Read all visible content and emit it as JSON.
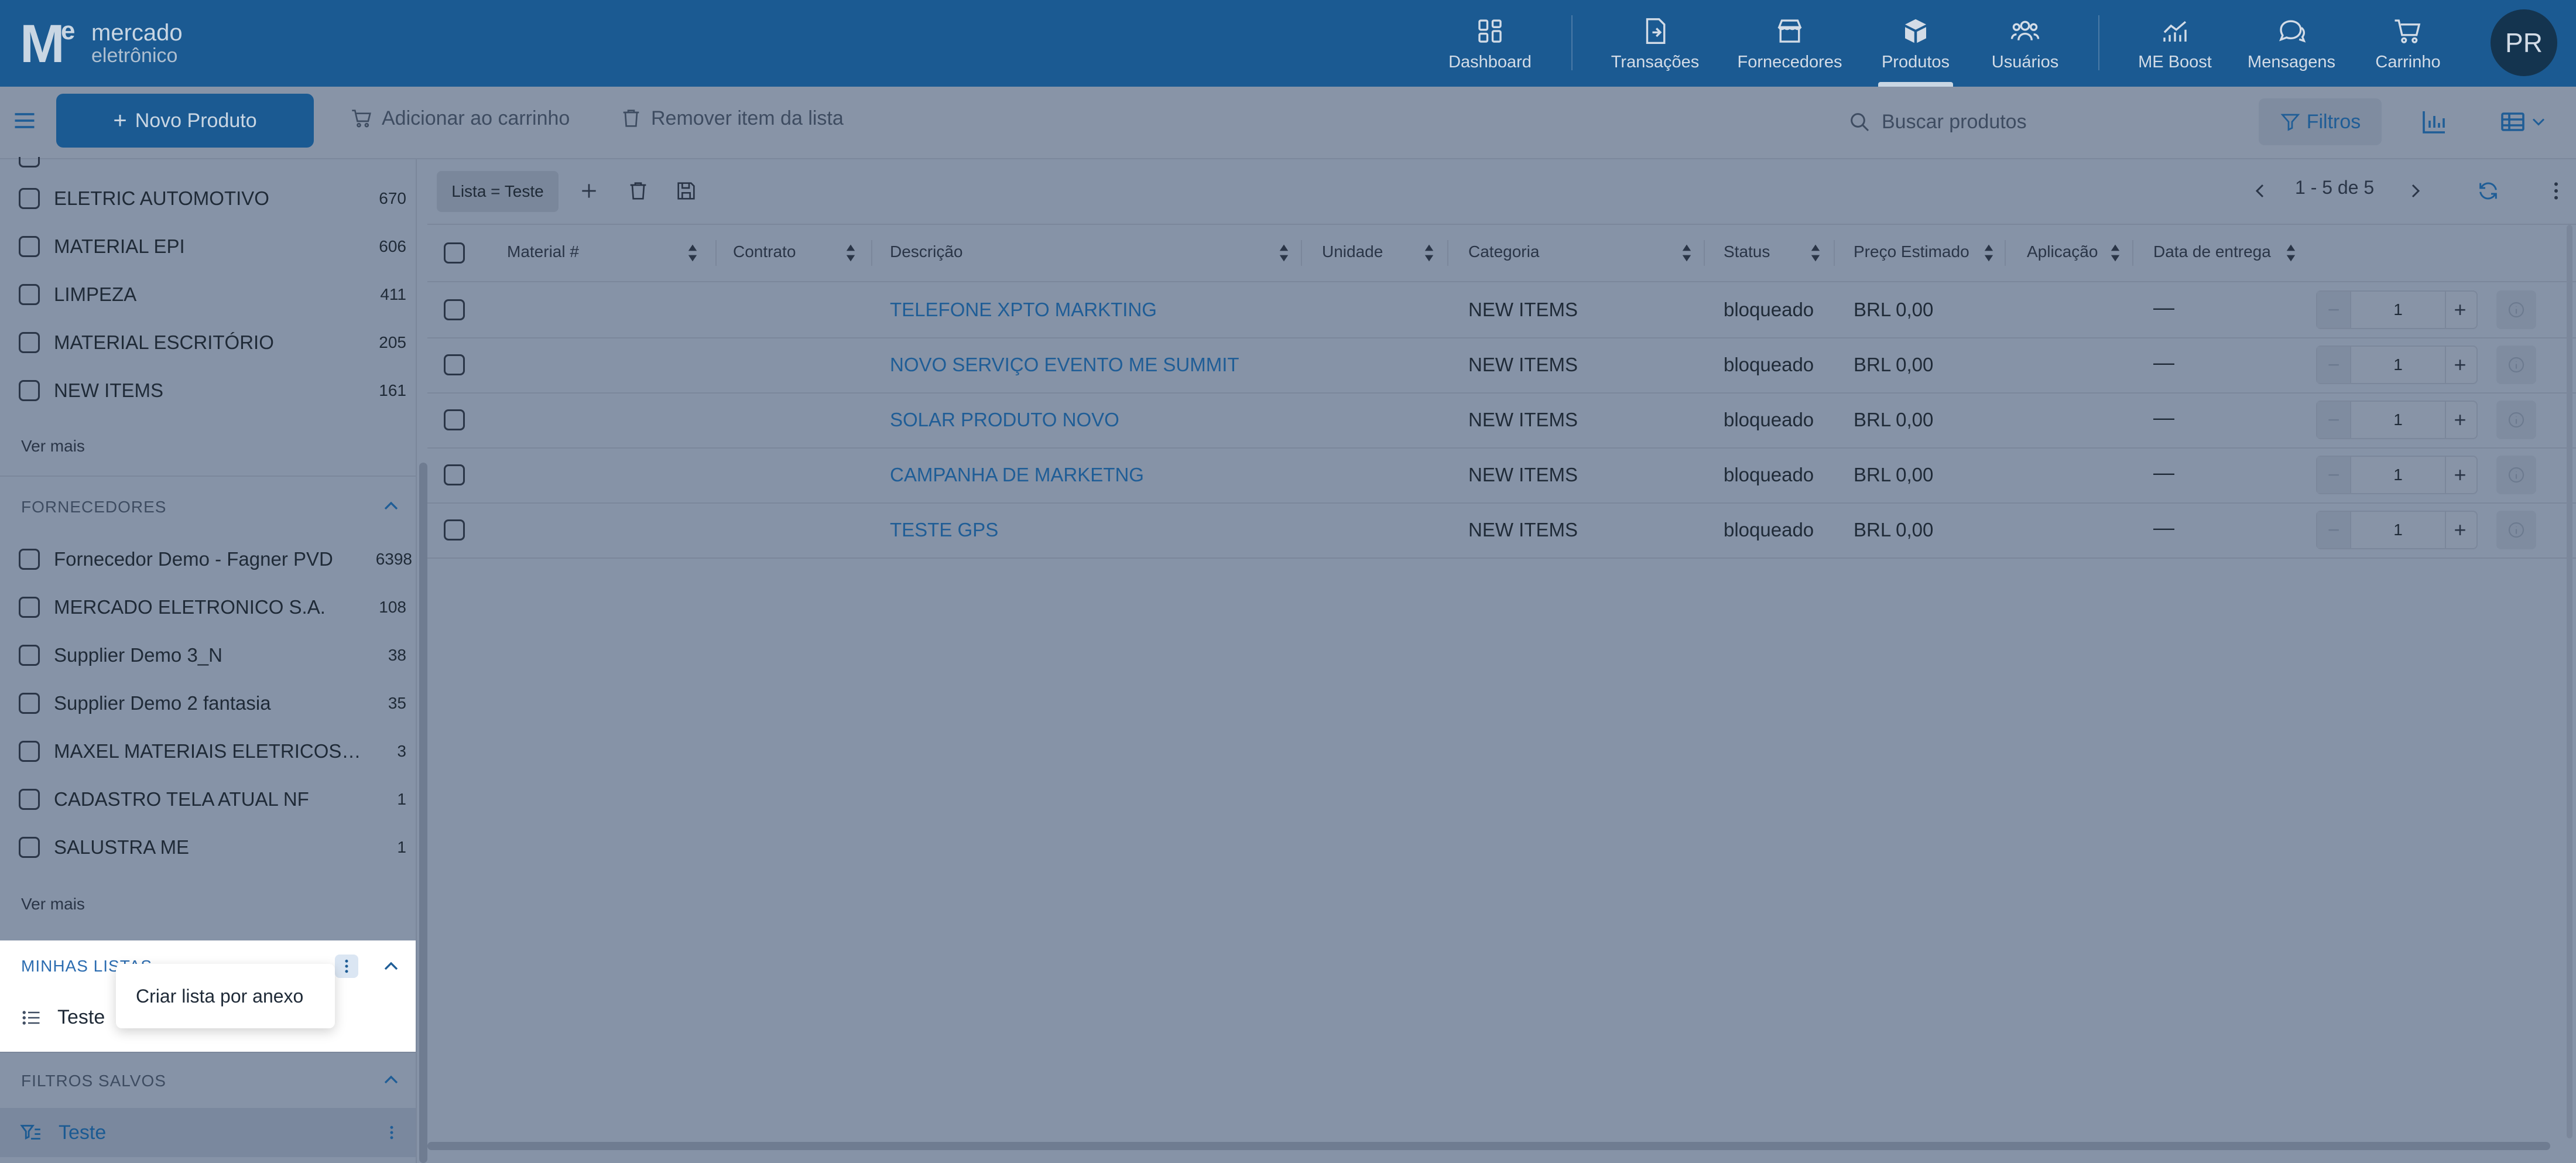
{
  "brand": {
    "line1": "mercado",
    "line2": "eletrônico",
    "mark_letter": "M",
    "mark_sup": "e"
  },
  "nav": {
    "items": [
      {
        "label": "Dashboard",
        "icon": "dashboard-icon"
      },
      {
        "label": "Transações",
        "icon": "transactions-icon"
      },
      {
        "label": "Fornecedores",
        "icon": "store-icon"
      },
      {
        "label": "Produtos",
        "icon": "box-icon",
        "active": true
      },
      {
        "label": "Usuários",
        "icon": "users-icon"
      },
      {
        "label": "ME Boost",
        "icon": "chart-line-icon"
      },
      {
        "label": "Mensagens",
        "icon": "chat-icon"
      },
      {
        "label": "Carrinho",
        "icon": "cart-icon"
      }
    ],
    "avatar": "PR"
  },
  "toolbar": {
    "new_product": "Novo Produto",
    "add_to_cart": "Adicionar ao carrinho",
    "remove_item": "Remover item da lista",
    "search_placeholder": "Buscar produtos",
    "filters": "Filtros"
  },
  "sidebar": {
    "categories": [
      {
        "label": "ELETRIC AUTOMOTIVO",
        "count": "670"
      },
      {
        "label": "MATERIAL EPI",
        "count": "606"
      },
      {
        "label": "LIMPEZA",
        "count": "411"
      },
      {
        "label": "MATERIAL ESCRITÓRIO",
        "count": "205"
      },
      {
        "label": "NEW ITEMS",
        "count": "161"
      }
    ],
    "see_more": "Ver mais",
    "suppliers_title": "FORNECEDORES",
    "suppliers": [
      {
        "label": "Fornecedor Demo - Fagner PVD",
        "count": "6398"
      },
      {
        "label": "MERCADO ELETRONICO S.A.",
        "count": "108"
      },
      {
        "label": "Supplier Demo 3_N",
        "count": "38"
      },
      {
        "label": "Supplier Demo 2 fantasia",
        "count": "35"
      },
      {
        "label": "MAXEL MATERIAIS ELETRICOS LT...",
        "count": "3"
      },
      {
        "label": "CADASTRO TELA ATUAL NF",
        "count": "1"
      },
      {
        "label": "SALUSTRA ME",
        "count": "1"
      }
    ],
    "my_lists_title": "MINHAS LISTAS",
    "my_lists_item": "Teste",
    "popup": "Criar lista por anexo",
    "saved_filters_title": "FILTROS SALVOS",
    "saved_filter_item": "Teste"
  },
  "main": {
    "chip": "Lista = Teste",
    "pagination": "1 - 5 de 5",
    "columns": [
      "Material #",
      "Contrato",
      "Descrição",
      "Unidade",
      "Categoria",
      "Status",
      "Preço Estimado",
      "Aplicação",
      "Data de entrega"
    ],
    "rows": [
      {
        "descricao": "TELEFONE XPTO MARKTING",
        "categoria": "NEW ITEMS",
        "status": "bloqueado",
        "preco": "BRL 0,00",
        "data": "—",
        "qty": "1"
      },
      {
        "descricao": "NOVO SERVIÇO EVENTO ME SUMMIT",
        "categoria": "NEW ITEMS",
        "status": "bloqueado",
        "preco": "BRL 0,00",
        "data": "—",
        "qty": "1"
      },
      {
        "descricao": "SOLAR PRODUTO NOVO",
        "categoria": "NEW ITEMS",
        "status": "bloqueado",
        "preco": "BRL 0,00",
        "data": "—",
        "qty": "1"
      },
      {
        "descricao": "CAMPANHA DE MARKETNG",
        "categoria": "NEW ITEMS",
        "status": "bloqueado",
        "preco": "BRL 0,00",
        "data": "—",
        "qty": "1"
      },
      {
        "descricao": "TESTE GPS",
        "categoria": "NEW ITEMS",
        "status": "bloqueado",
        "preco": "BRL 0,00",
        "data": "—",
        "qty": "1"
      }
    ]
  },
  "colors": {
    "brand": "#1b5a92",
    "overlay": "#8693a7",
    "link": "#1f5d96"
  }
}
